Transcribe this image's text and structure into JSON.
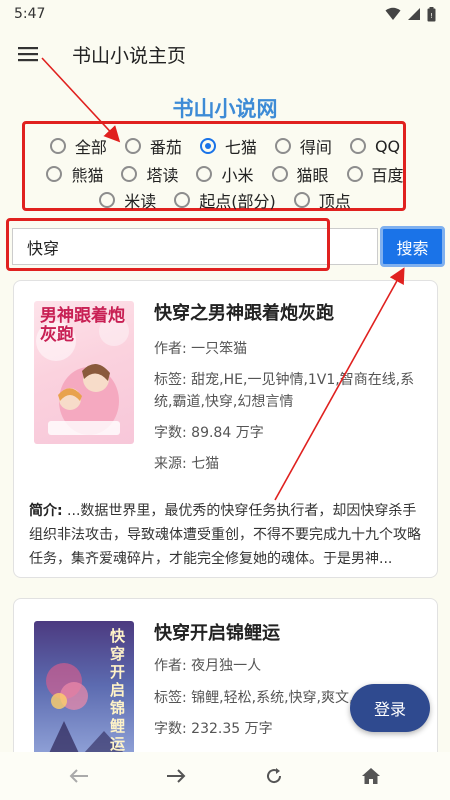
{
  "status": {
    "time": "5:47"
  },
  "appbar": {
    "title": "书山小说主页"
  },
  "site": {
    "title": "书山小说网"
  },
  "sources": {
    "row1": [
      "全部",
      "番茄",
      "七猫",
      "得间",
      "QQ"
    ],
    "row2": [
      "熊猫",
      "塔读",
      "小米",
      "猫眼",
      "百度"
    ],
    "row3": [
      "米读",
      "起点(部分)",
      "顶点"
    ],
    "selected": "七猫"
  },
  "search": {
    "value": "快穿",
    "button": "搜索"
  },
  "books": [
    {
      "title": "快穿之男神跟着炮灰跑",
      "author": "作者: 一只笨猫",
      "tags": "标签: 甜宠,HE,一见钟情,1V1,智商在线,系统,霸道,快穿,幻想言情",
      "words": "字数: 89.84 万字",
      "source": "来源: 七猫",
      "intro_label": "简介:",
      "intro": " ...数据世界里，最优秀的快穿任务执行者，却因快穿杀手组织非法攻击，导致魂体遭受重创，不得不要完成九十九个攻略任务，集齐爱魂碎片，才能完全修复她的魂体。于是男神...",
      "cover_text": "男神跟着炮灰跑"
    },
    {
      "title": "快穿开启锦鲤运",
      "author": "作者: 夜月独一人",
      "tags": "标签: 锦鲤,轻松,系统,快穿,爽文,分",
      "words": "字数: 232.35 万字",
      "cover_text": "快穿开启锦鲤运"
    }
  ],
  "login": {
    "label": "登录"
  },
  "colors": {
    "accent": "#1a73e8",
    "annotation": "#e0211f",
    "site_title": "#3d8bd6",
    "login": "#2f4a8f"
  }
}
